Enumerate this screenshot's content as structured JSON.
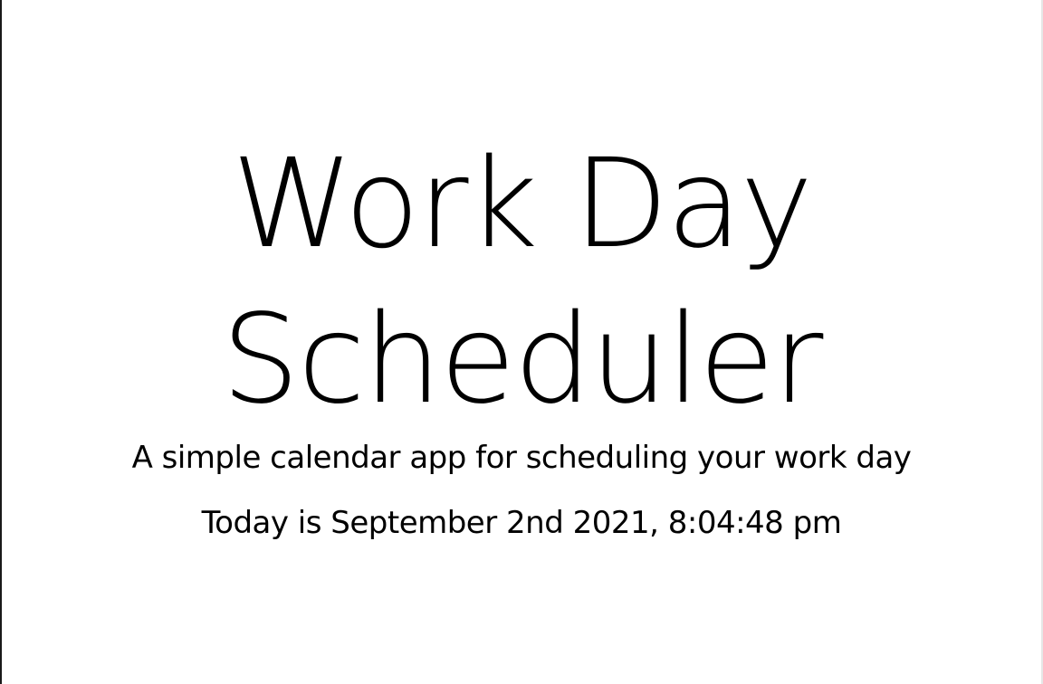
{
  "header": {
    "title_line1": "Work Day",
    "title_line2": "Scheduler",
    "lead": "A simple calendar app for scheduling your work day",
    "current_day": "Today is September 2nd 2021, 8:04:48 pm"
  }
}
